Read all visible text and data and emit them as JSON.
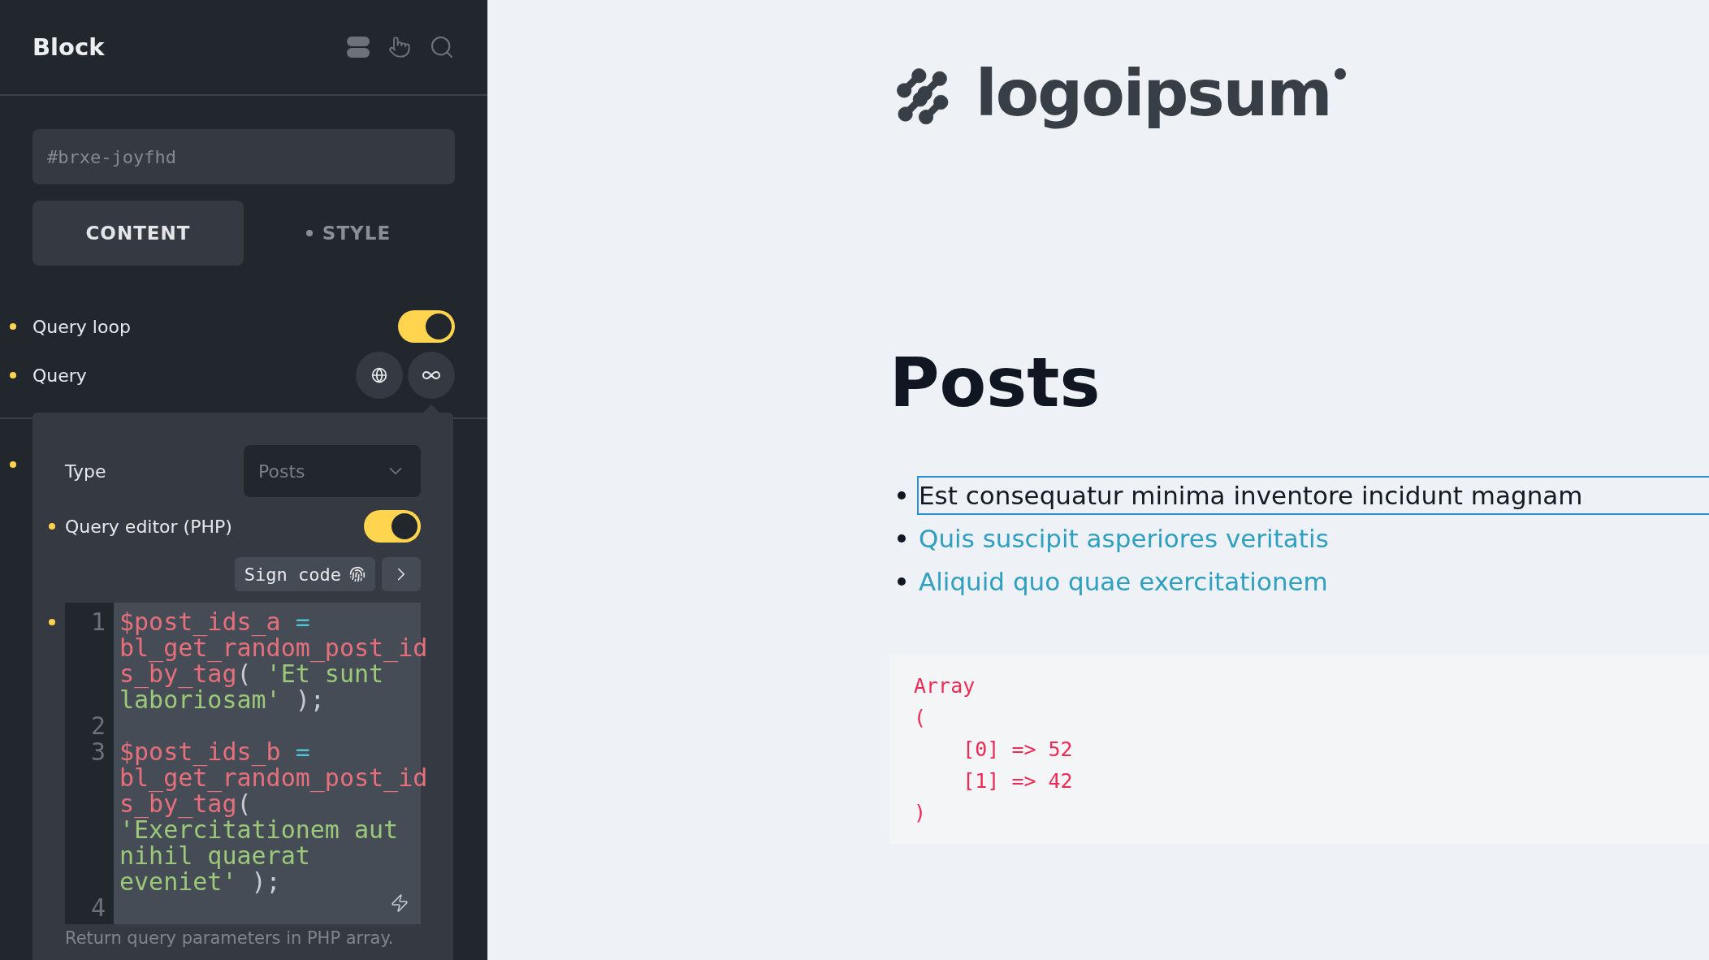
{
  "panel": {
    "title": "Block",
    "id_field": {
      "placeholder": "#brxe-joyfhd"
    },
    "tabs": [
      {
        "label": "CONTENT",
        "selected": true,
        "dot": false
      },
      {
        "label": "STYLE",
        "selected": false,
        "dot": true
      }
    ],
    "settings": [
      {
        "kind": "toggle",
        "label": "Query loop",
        "modified": true,
        "on": true
      },
      {
        "kind": "buttons",
        "label": "Query",
        "modified": true
      },
      {
        "kind": "covered",
        "modified": true
      }
    ],
    "popup": {
      "type_row": {
        "label": "Type",
        "value": "Posts"
      },
      "editor_toggle": {
        "label": "Query editor (PHP)",
        "modified": true,
        "on": true
      },
      "sign_button": "Sign code",
      "code": {
        "modified": true,
        "lines": [
          {
            "number": "1",
            "tokens": [
              {
                "kind": "variable",
                "text": "$post_ids_a"
              },
              {
                "kind": "operator",
                "text": " = "
              },
              {
                "kind": "function",
                "text": "bl_get_random_post_ids_by_tag"
              },
              {
                "kind": "punct",
                "text": "( "
              },
              {
                "kind": "string",
                "text": "'Et sunt laboriosam'"
              },
              {
                "kind": "punct",
                "text": " );"
              }
            ]
          },
          {
            "number": "2"
          },
          {
            "number": "3",
            "tokens": [
              {
                "kind": "variable",
                "text": "$post_ids_b"
              },
              {
                "kind": "operator",
                "text": " = "
              },
              {
                "kind": "function",
                "text": "bl_get_random_post_ids_by_tag"
              },
              {
                "kind": "punct",
                "text": "( "
              },
              {
                "kind": "string",
                "text": "'Exercitationem aut nihil quaerat eveniet'"
              },
              {
                "kind": "punct",
                "text": " );"
              }
            ]
          },
          {
            "number": "4"
          }
        ]
      },
      "help": "Return query parameters in PHP array."
    }
  },
  "preview": {
    "logo": "logoipsum",
    "heading": "Posts",
    "posts": [
      {
        "title": "Est consequatur minima inventore incidunt magnam",
        "selected": true
      },
      {
        "title": "Quis suscipit asperiores veritatis",
        "selected": false
      },
      {
        "title": "Aliquid quo quae exercitationem",
        "selected": false
      }
    ],
    "output": [
      "Array",
      "(",
      "    [0] => 52",
      "    [1] => 42",
      ")"
    ]
  }
}
